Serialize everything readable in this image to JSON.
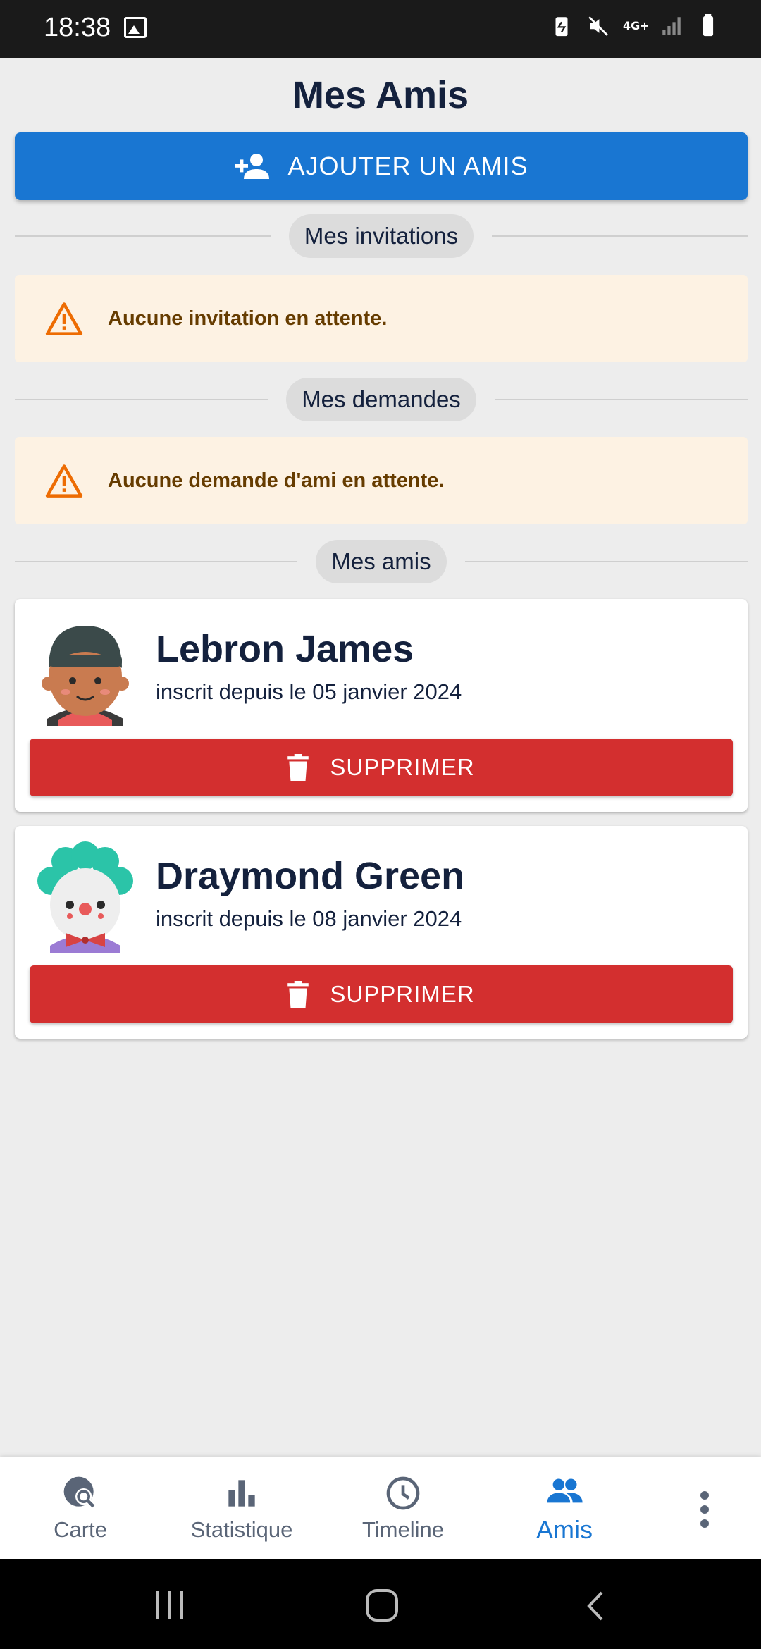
{
  "status_bar": {
    "time": "18:38",
    "network": "4G+"
  },
  "page": {
    "title": "Mes Amis"
  },
  "add_button": {
    "label": "AJOUTER UN AMIS",
    "icon": "person-add-icon",
    "color": "#1976d2"
  },
  "sections": {
    "invitations": {
      "label": "Mes invitations",
      "empty_text": "Aucune invitation en attente."
    },
    "requests": {
      "label": "Mes demandes",
      "empty_text": "Aucune demande d'ami en attente."
    },
    "friends": {
      "label": "Mes amis"
    }
  },
  "friends": [
    {
      "name": "Lebron James",
      "since": "inscrit depuis le 05 janvier 2024",
      "avatar": "boy-avatar",
      "delete_label": "SUPPRIMER"
    },
    {
      "name": "Draymond Green",
      "since": "inscrit depuis le 08 janvier 2024",
      "avatar": "clown-avatar",
      "delete_label": "SUPPRIMER"
    }
  ],
  "bottom_nav": {
    "items": [
      {
        "label": "Carte",
        "icon": "map-search-icon",
        "active": false
      },
      {
        "label": "Statistique",
        "icon": "bar-chart-icon",
        "active": false
      },
      {
        "label": "Timeline",
        "icon": "clock-icon",
        "active": false
      },
      {
        "label": "Amis",
        "icon": "people-icon",
        "active": true
      }
    ],
    "more_icon": "more-vert-icon"
  },
  "colors": {
    "primary": "#1976d2",
    "danger": "#d32f2f",
    "warning_bg": "#fdf2e3",
    "warning_text": "#663c00",
    "warning_icon": "#ed6c02"
  }
}
